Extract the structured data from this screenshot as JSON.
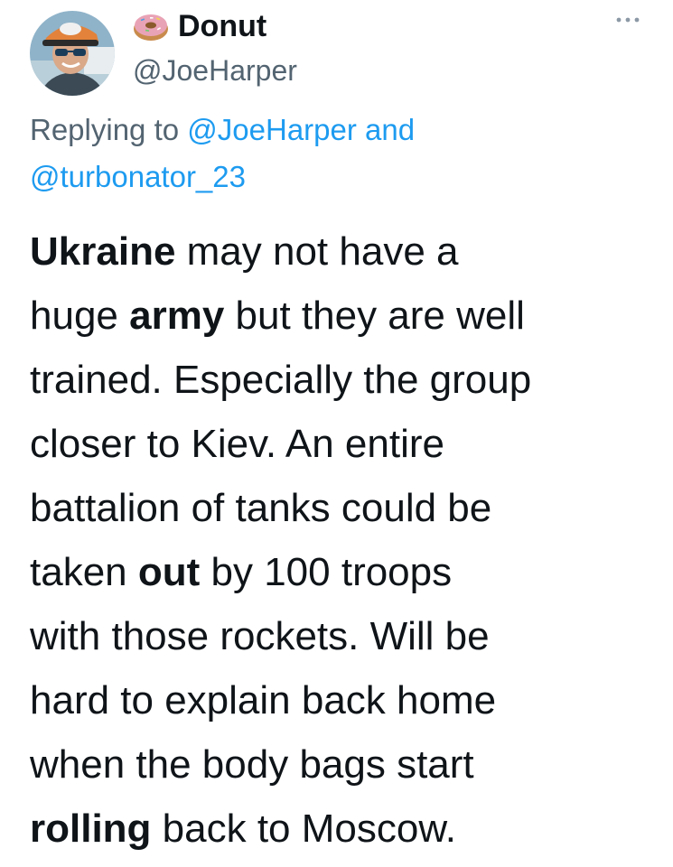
{
  "tweet": {
    "author": {
      "display_name": "Donut",
      "handle": "@JoeHarper",
      "name_emoji": "donut-icon",
      "avatar": "avatar-photo"
    },
    "more_icon": "more-dots-icon",
    "reply_context": {
      "prefix": "Replying to",
      "mention_1": "@JoeHarper",
      "joiner": " and",
      "mention_2": "@turbonator_23"
    },
    "body": {
      "line1_bold": "Ukraine",
      "line1_rest": " may not have a",
      "line2_pre": "huge ",
      "line2_bold": "army",
      "line2_rest": " but they are well",
      "line3": "trained. Especially the group",
      "line4": "closer to Kiev. An entire",
      "line5": "battalion of tanks could be",
      "line6_pre": "taken ",
      "line6_bold": "out",
      "line6_rest": " by 100 troops",
      "line7": "with those rockets. Will be",
      "line8": "hard to explain back home",
      "line9": "when the body bags start",
      "line10_bold": "rolling",
      "line10_rest": " back to Moscow."
    },
    "colors": {
      "text": "#0f1419",
      "secondary": "#536471",
      "link": "#1d9bf0"
    }
  }
}
